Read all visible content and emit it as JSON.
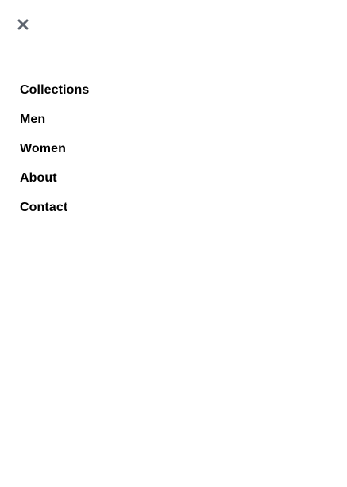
{
  "menu": {
    "close_icon": "close-icon",
    "close_color": "#5f6670",
    "items": [
      {
        "label": "Collections"
      },
      {
        "label": "Men"
      },
      {
        "label": "Women"
      },
      {
        "label": "About"
      },
      {
        "label": "Contact"
      }
    ]
  }
}
